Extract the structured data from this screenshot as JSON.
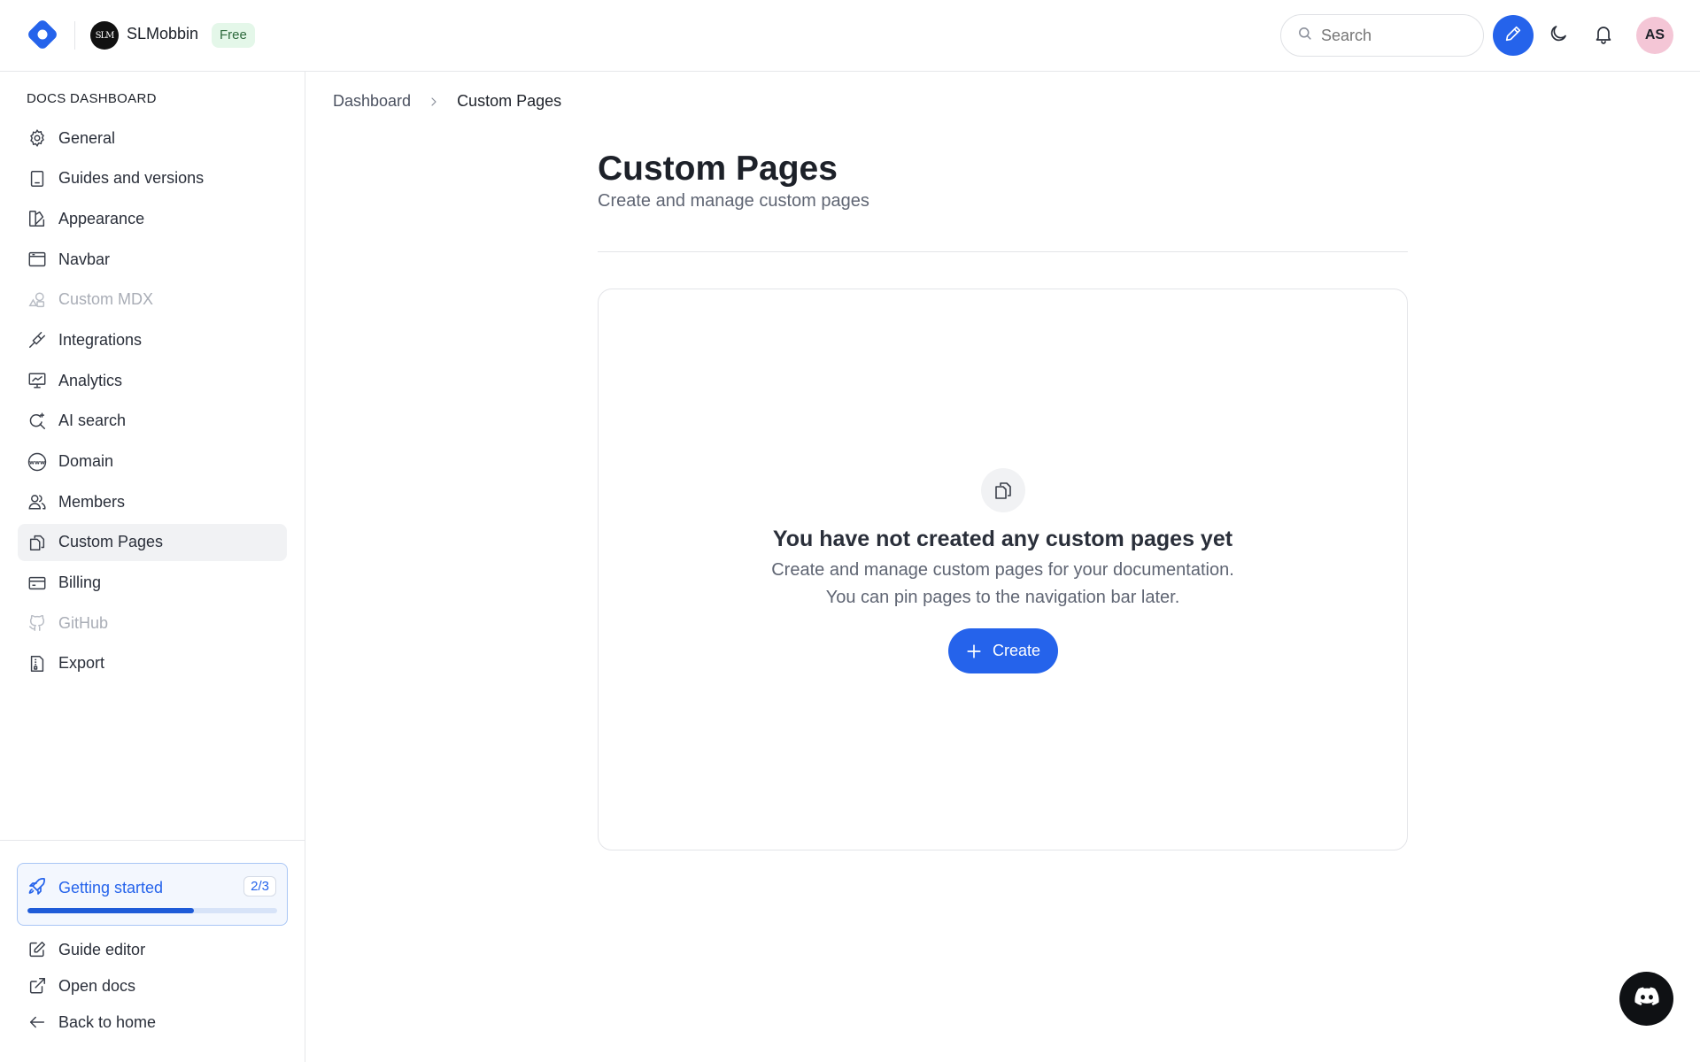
{
  "app": {
    "workspace_name": "SLMobbin",
    "workspace_avatar_text": "SLM",
    "plan_badge": "Free",
    "search_placeholder": "Search",
    "user_initials": "AS",
    "accent_color": "#2563eb"
  },
  "sidebar": {
    "heading": "DOCS DASHBOARD",
    "items": [
      {
        "label": "General",
        "icon": "gear-icon",
        "state": "normal"
      },
      {
        "label": "Guides and versions",
        "icon": "book-icon",
        "state": "normal"
      },
      {
        "label": "Appearance",
        "icon": "palette-icon",
        "state": "normal"
      },
      {
        "label": "Navbar",
        "icon": "browser-window-icon",
        "state": "normal"
      },
      {
        "label": "Custom MDX",
        "icon": "shapes-icon",
        "state": "disabled"
      },
      {
        "label": "Integrations",
        "icon": "plug-icon",
        "state": "normal"
      },
      {
        "label": "Analytics",
        "icon": "presentation-chart-icon",
        "state": "normal"
      },
      {
        "label": "AI search",
        "icon": "sparkle-search-icon",
        "state": "normal"
      },
      {
        "label": "Domain",
        "icon": "globe-www-icon",
        "state": "normal"
      },
      {
        "label": "Members",
        "icon": "users-icon",
        "state": "normal"
      },
      {
        "label": "Custom Pages",
        "icon": "files-icon",
        "state": "active"
      },
      {
        "label": "Billing",
        "icon": "credit-card-icon",
        "state": "normal"
      },
      {
        "label": "GitHub",
        "icon": "github-icon",
        "state": "disabled"
      },
      {
        "label": "Export",
        "icon": "file-export-icon",
        "state": "normal"
      }
    ],
    "getting_started": {
      "label": "Getting started",
      "count": "2/3",
      "progress": 0.667
    },
    "bottom_links": [
      {
        "label": "Guide editor",
        "icon": "edit-square-icon"
      },
      {
        "label": "Open docs",
        "icon": "external-link-icon"
      },
      {
        "label": "Back to home",
        "icon": "arrow-left-icon"
      }
    ]
  },
  "breadcrumb": {
    "parent": "Dashboard",
    "current": "Custom Pages"
  },
  "page": {
    "title": "Custom Pages",
    "subtitle": "Create and manage custom pages"
  },
  "empty_state": {
    "title": "You have not created any custom pages yet",
    "line1": "Create and manage custom pages for your documentation.",
    "line2": "You can pin pages to the navigation bar later.",
    "button_label": "Create"
  }
}
